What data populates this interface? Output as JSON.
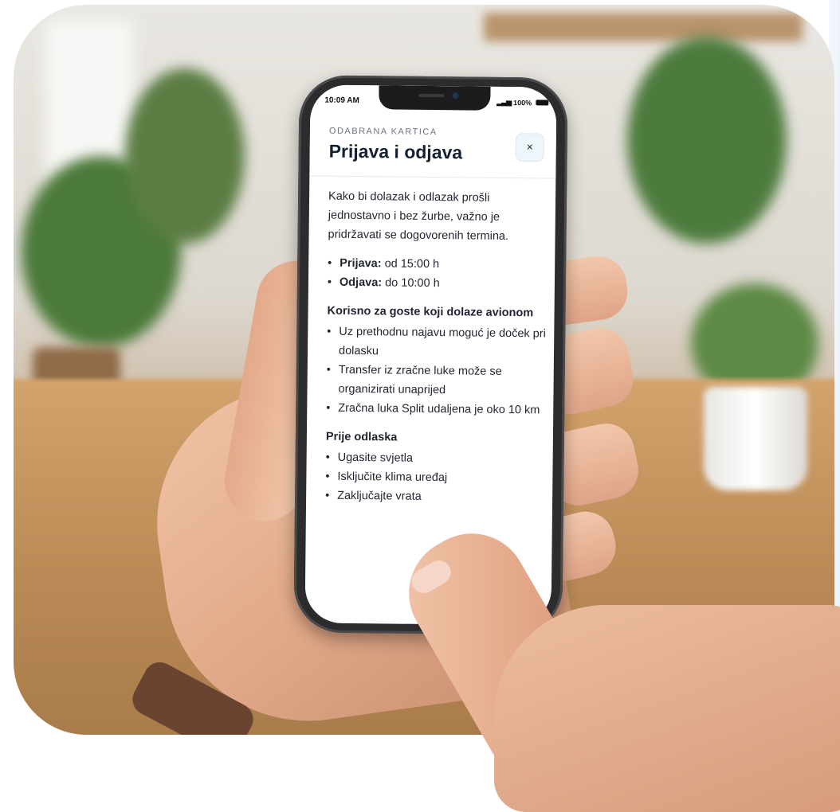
{
  "status_bar": {
    "time": "10:09 AM",
    "battery": "100%"
  },
  "card": {
    "eyebrow": "ODABRANA KARTICA",
    "title": "Prijava i odjava",
    "close_label": "×",
    "intro": "Kako bi dolazak i odlazak prošli jednostavno i bez žurbe, važno je pridržavati se dogovorenih termina.",
    "times": [
      {
        "label": "Prijava:",
        "value": "od 15:00 h"
      },
      {
        "label": "Odjava:",
        "value": "do 10:00 h"
      }
    ],
    "sections": [
      {
        "title": "Korisno za goste koji dolaze avionom",
        "items": [
          "Uz prethodnu najavu moguć je doček pri dolasku",
          "Transfer iz zračne luke može se organizirati unaprijed",
          "Zračna luka Split udaljena je oko 10 km"
        ]
      },
      {
        "title": "Prije odlaska",
        "items": [
          "Ugasite svjetla",
          "Isključite klima uređaj",
          "Zaključajte vrata"
        ]
      }
    ]
  },
  "icons": {
    "close": "close-icon",
    "signal": "signal-icon",
    "battery": "battery-icon"
  }
}
